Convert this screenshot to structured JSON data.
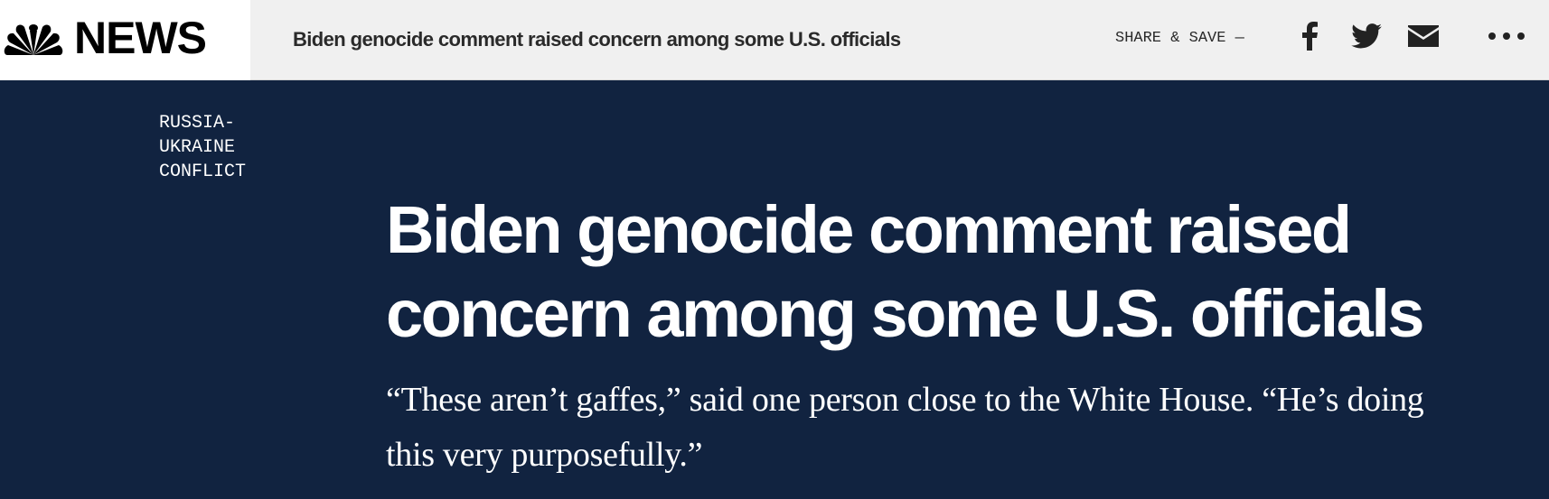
{
  "header": {
    "logo_text": "NEWS",
    "article_title": "Biden genocide comment raised concern among some U.S. officials",
    "share_label": "SHARE & SAVE —",
    "icons": [
      "peacock-logo-icon",
      "facebook-icon",
      "twitter-icon",
      "email-icon",
      "more-icon"
    ]
  },
  "article": {
    "section": "RUSSIA-UKRAINE CONFLICT",
    "headline": "Biden genocide comment raised concern among some U.S. officials",
    "dek": "“These aren’t gaffes,” said one person close to the White House. “He’s doing this very purposefully.”"
  },
  "colors": {
    "hero_background": "#112340",
    "topbar_background": "#f0f0f0"
  }
}
